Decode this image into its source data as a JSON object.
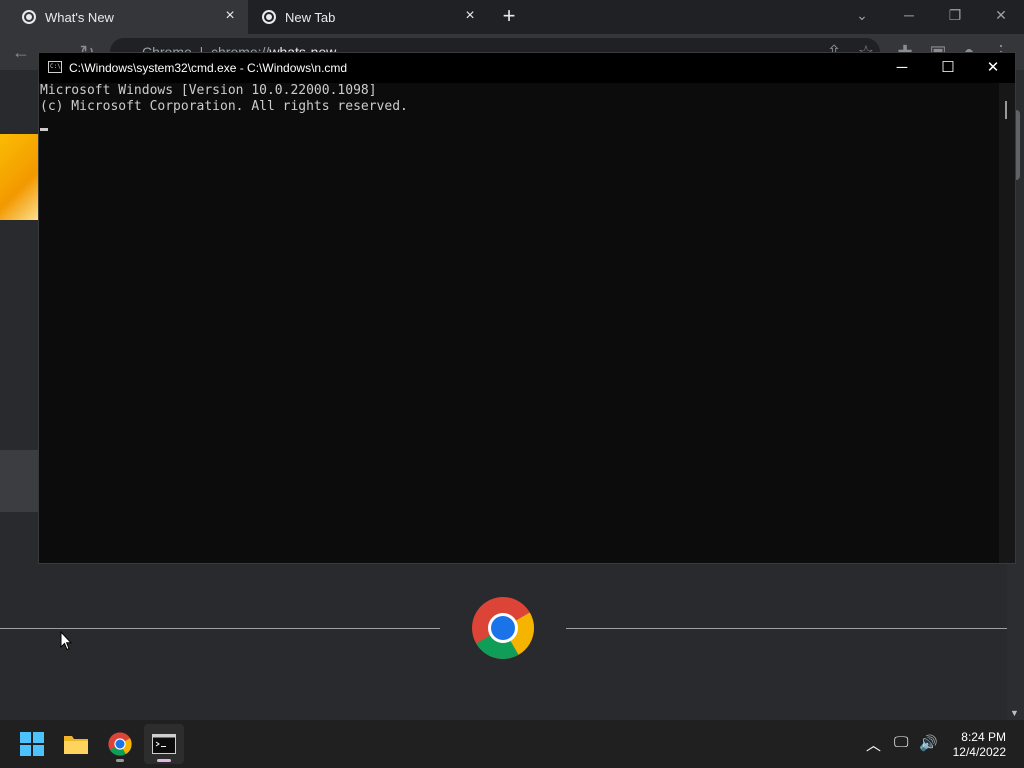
{
  "browser": {
    "tabs": [
      {
        "title": "What's New",
        "active": true
      },
      {
        "title": "New Tab",
        "active": false
      }
    ],
    "new_tab_icon": "plus-icon",
    "address": {
      "prefix": "Chrome",
      "scheme": "chrome://",
      "path": "whats-new"
    }
  },
  "cmd_window": {
    "title": "C:\\Windows\\system32\\cmd.exe - C:\\Windows\\n.cmd",
    "app_icon_text": "C:\\",
    "minimize_icon": "─",
    "maximize_icon": "☐",
    "close_icon": "✕",
    "lines": [
      "Microsoft Windows [Version 10.0.22000.1098]",
      "(c) Microsoft Corporation. All rights reserved."
    ]
  },
  "taskbar": {
    "apps": [
      "start-button",
      "file-explorer",
      "chrome",
      "command-prompt"
    ],
    "clock": {
      "time": "8:24 PM",
      "date": "12/4/2022"
    }
  },
  "colors": {
    "chrome_frame": "#202124",
    "chrome_toolbar": "#35363a",
    "cmd_background": "#0c0c0c",
    "cmd_text": "#cccccc",
    "taskbar": "#202020"
  }
}
